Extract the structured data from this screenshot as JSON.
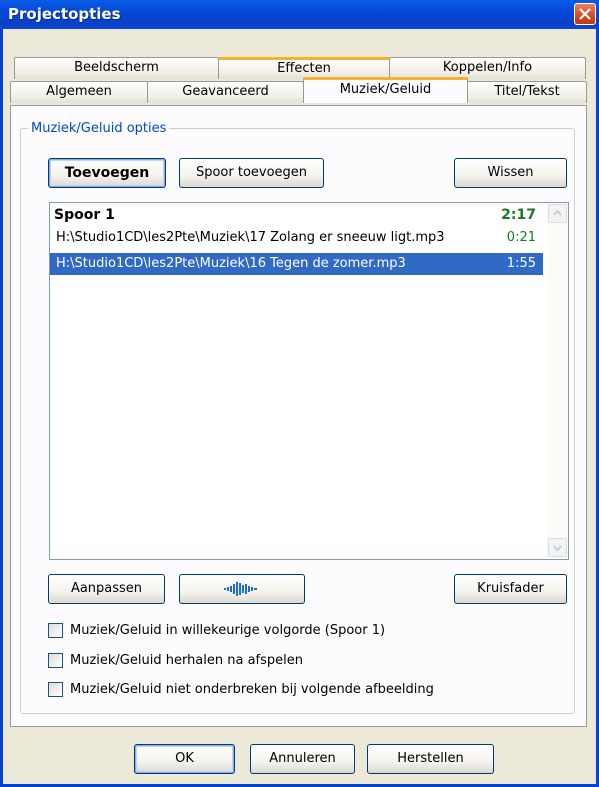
{
  "window": {
    "title": "Projectopties"
  },
  "tabs": {
    "back_row": [
      "Beeldscherm",
      "Effecten",
      "Koppelen/Info"
    ],
    "front_row": [
      "Algemeen",
      "Geavanceerd",
      "Muziek/Geluid",
      "Titel/Tekst"
    ],
    "selected": "Muziek/Geluid"
  },
  "group": {
    "legend": "Muziek/Geluid opties",
    "buttons": {
      "add": "Toevoegen",
      "add_track": "Spoor toevoegen",
      "clear": "Wissen",
      "edit": "Aanpassen",
      "waveform_icon": "waveform-icon",
      "crossfader": "Kruisfader"
    },
    "tracklist": {
      "track_name": "Spoor 1",
      "track_duration": "2:17",
      "items": [
        {
          "path": "H:\\Studio1CD\\les2Pte\\Muziek\\17 Zolang er sneeuw ligt.mp3",
          "duration": "0:21"
        },
        {
          "path": "H:\\Studio1CD\\les2Pte\\Muziek\\16 Tegen de zomer.mp3",
          "duration": "1:55"
        }
      ]
    },
    "options": [
      {
        "label": "Muziek/Geluid in willekeurige volgorde (Spoor 1)",
        "checked": false
      },
      {
        "label": "Muziek/Geluid herhalen na afspelen",
        "checked": false
      },
      {
        "label": "Muziek/Geluid niet onderbreken bij volgende afbeelding",
        "checked": false
      }
    ]
  },
  "footer": {
    "ok": "OK",
    "cancel": "Annuleren",
    "reset": "Herstellen"
  },
  "colors": {
    "accent": "#316ac5",
    "duration_green": "#157a1f",
    "legend_blue": "#0046d5",
    "tab_highlight": "#f8b12c"
  }
}
